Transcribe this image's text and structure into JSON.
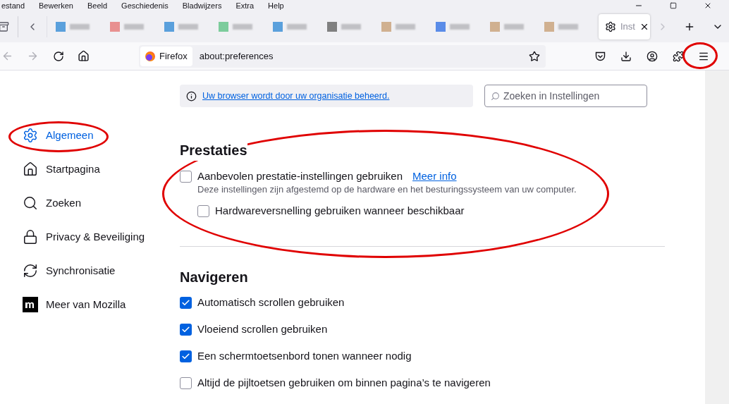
{
  "menu_bar": [
    "estand",
    "Bewerken",
    "Beeld",
    "Geschiedenis",
    "Bladwijzers",
    "Extra",
    "Help"
  ],
  "tabs": [
    {
      "kind": "blurred",
      "color": "#5aa0dc"
    },
    {
      "kind": "blurred",
      "color": "#e89090"
    },
    {
      "kind": "blurred",
      "color": "#5aa0dc"
    },
    {
      "kind": "blurred",
      "color": "#7ccc9c"
    },
    {
      "kind": "blurred",
      "color": "#5aa0dc"
    },
    {
      "kind": "blurred",
      "color": "#808080"
    },
    {
      "kind": "blurred",
      "color": "#d0b090"
    },
    {
      "kind": "blurred",
      "color": "#5a8ce8"
    },
    {
      "kind": "blurred",
      "color": "#d0b090"
    },
    {
      "kind": "blurred",
      "color": "#d0b090"
    },
    {
      "label": "Inst",
      "kind": "settings",
      "selected": true
    }
  ],
  "address_bar": {
    "identity": "Firefox",
    "url": "about:preferences"
  },
  "notice": {
    "link": "Uw browser wordt door uw organisatie beheerd."
  },
  "search": {
    "placeholder": "Zoeken in Instellingen"
  },
  "sidebar": {
    "items": [
      {
        "label": "Algemeen",
        "kind": "general",
        "selected": true
      },
      {
        "label": "Startpagina",
        "kind": "home",
        "selected": false
      },
      {
        "label": "Zoeken",
        "kind": "search",
        "selected": false
      },
      {
        "label": "Privacy & Beveiliging",
        "kind": "privacy",
        "selected": false
      },
      {
        "label": "Synchronisatie",
        "kind": "sync",
        "selected": false
      },
      {
        "label": "Meer van Mozilla",
        "kind": "mozilla",
        "selected": false
      }
    ]
  },
  "sections": [
    {
      "title": "Prestaties",
      "options": [
        {
          "label": "Aanbevolen prestatie-instellingen gebruiken",
          "checked": false,
          "link": "Meer info",
          "description": "Deze instellingen zijn afgestemd op de hardware en het besturingssysteem van uw computer.",
          "children": [
            {
              "label": "Hardwareversnelling gebruiken wanneer beschikbaar",
              "checked": false
            }
          ]
        }
      ]
    },
    {
      "title": "Navigeren",
      "options": [
        {
          "label": "Automatisch scrollen gebruiken",
          "checked": true
        },
        {
          "label": "Vloeiend scrollen gebruiken",
          "checked": true
        },
        {
          "label": "Een schermtoetsenbord tonen wanneer nodig",
          "checked": true
        },
        {
          "label": "Altijd de pijltoetsen gebruiken om binnen pagina’s te navigeren",
          "checked": false
        }
      ]
    }
  ]
}
